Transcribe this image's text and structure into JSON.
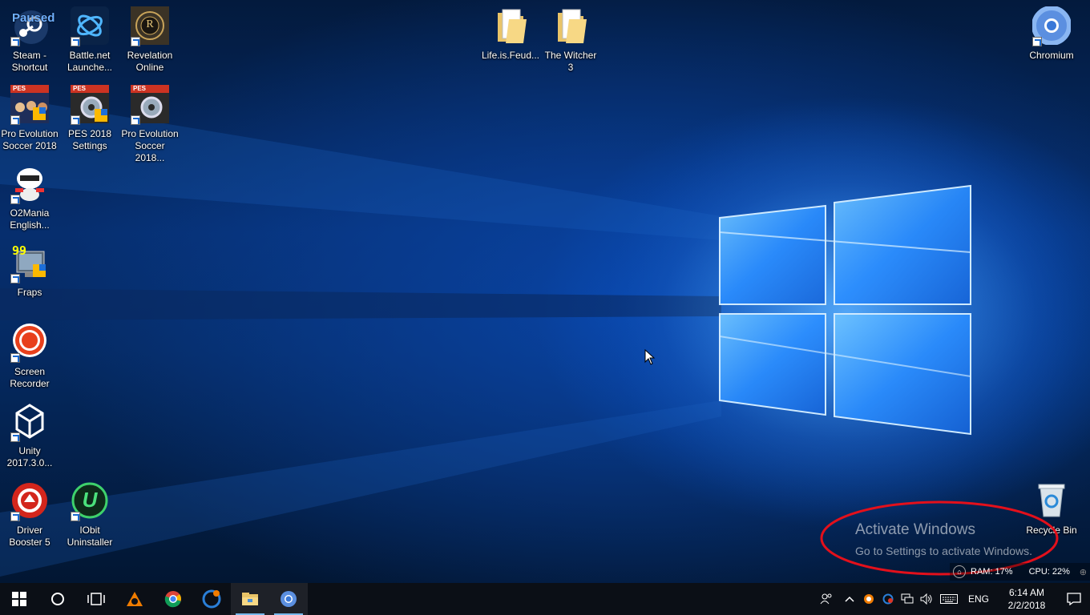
{
  "desktop": {
    "icons": [
      {
        "id": "steam",
        "label": "Steam -\nShortcut",
        "badge": "Paused"
      },
      {
        "id": "battlenet",
        "label": "Battle.net\nLaunche..."
      },
      {
        "id": "revelation",
        "label": "Revelation\nOnline",
        "glyph": "R"
      },
      {
        "id": "pes2018",
        "label": "Pro Evolution\nSoccer 2018",
        "badge": "PES"
      },
      {
        "id": "pes-settings",
        "label": "PES 2018\nSettings",
        "badge": "PES"
      },
      {
        "id": "pes2018-2",
        "label": "Pro Evolution\nSoccer 2018...",
        "badge": "PES"
      },
      {
        "id": "o2mania",
        "label": "O2Mania\nEnglish..."
      },
      {
        "id": "fraps",
        "label": "Fraps",
        "badge": "99"
      },
      {
        "id": "screen-recorder",
        "label": "Screen\nRecorder"
      },
      {
        "id": "unity",
        "label": "Unity\n2017.3.0..."
      },
      {
        "id": "driver-booster",
        "label": "Driver\nBooster 5"
      },
      {
        "id": "iobit",
        "label": "IObit\nUninstaller",
        "glyph": "U"
      },
      {
        "id": "lifeisfeud",
        "label": "Life.is.Feud..."
      },
      {
        "id": "witcher",
        "label": "The Witcher\n3"
      },
      {
        "id": "chromium",
        "label": "Chromium"
      },
      {
        "id": "recycle-bin",
        "label": "Recycle Bin"
      }
    ]
  },
  "activation": {
    "title": "Activate Windows",
    "subtitle": "Go to Settings to activate Windows."
  },
  "monitor": {
    "ram": "RAM: 17%",
    "cpu": "CPU: 22%"
  },
  "taskbar": {
    "apps": [
      "start",
      "cortana",
      "task-view",
      "avast",
      "chrome",
      "ccleaner",
      "file-explorer",
      "chromium"
    ],
    "language": "ENG",
    "time": "6:14 AM",
    "date": "2/2/2018"
  },
  "colors": {
    "wallpaper_accent": "#2f8bff",
    "taskbar": "#0b0f16",
    "annotation": "#e3101b"
  }
}
